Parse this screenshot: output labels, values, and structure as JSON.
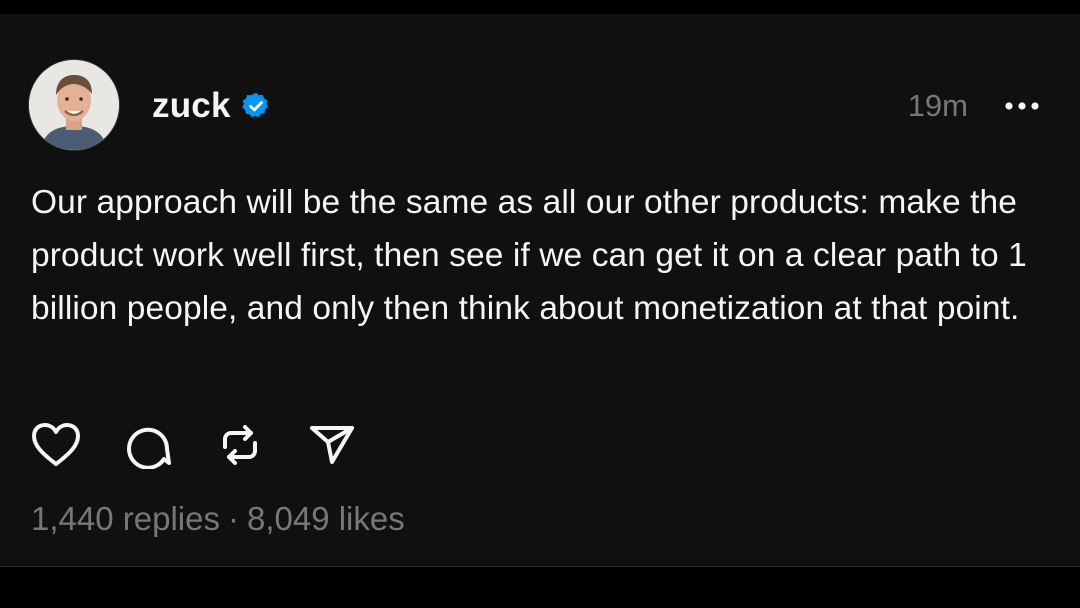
{
  "post": {
    "username": "zuck",
    "timestamp": "19m",
    "text": "Our approach will be the same as all our other products: make the product work well first, then see if we can get it on a clear path to 1 billion people, and only then think about monetization at that point.",
    "replies": "1,440 replies",
    "separator": "·",
    "likes": "8,049 likes"
  },
  "icons": {
    "verified": "verified-badge-icon",
    "more": "more-options-icon",
    "like": "heart-icon",
    "reply": "comment-icon",
    "repost": "repost-icon",
    "share": "send-icon"
  },
  "colors": {
    "background": "#101010",
    "text": "#f3f5f7",
    "muted": "#777777",
    "verified": "#0095f6"
  }
}
